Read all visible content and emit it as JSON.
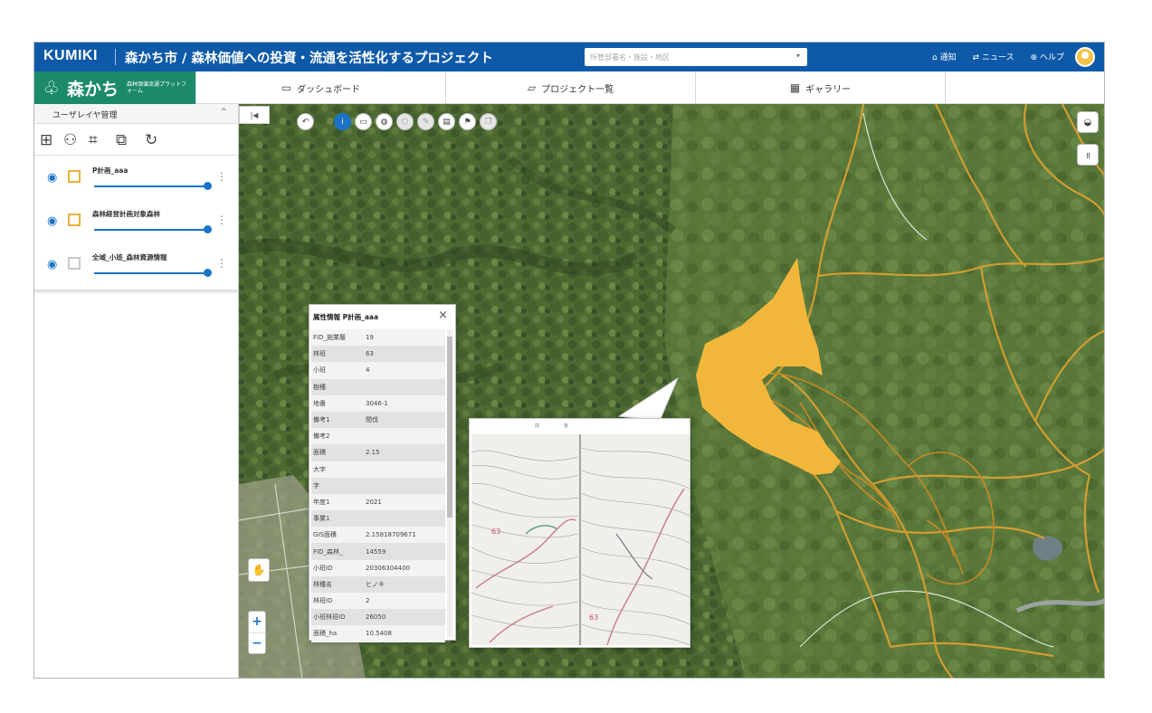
{
  "header": {
    "brand": "KUMIKI",
    "project_title": "森かち市 / 森林価値への投資・流通を活性化するプロジェクト",
    "search_placeholder": "所管部署名・施設・地区",
    "nav": [
      "通知",
      "ニュース",
      "ヘルプ"
    ]
  },
  "logo": {
    "mark": "♧",
    "name": "森かち",
    "tagline": "森林価値流通プラットフォーム"
  },
  "tabs": [
    {
      "label": "ダッシュボード",
      "icon": "monitor-icon"
    },
    {
      "label": "プロジェクト一覧",
      "icon": "folder-icon"
    },
    {
      "label": "ギャラリー",
      "icon": "gallery-icon"
    }
  ],
  "left_panel": {
    "title": "ユーザレイヤ管理",
    "collapse": "^",
    "layers": [
      {
        "name": "P計画_aaa",
        "opacity": 1.0,
        "color": "#e7b13a"
      },
      {
        "name": "森林経営計画対象森林",
        "opacity": 1.0,
        "color": "#e7b13a"
      },
      {
        "name": "全域_小班_森林資源情報",
        "opacity": 1.0,
        "color": "#c9c9c9"
      }
    ]
  },
  "map": {
    "collapse_label": "|◀",
    "zoom_in": "+",
    "zoom_out": "−"
  },
  "popup": {
    "title": "属性情報 P計画_aaa",
    "close": "×",
    "rows": [
      [
        "FID_施業履",
        "19"
      ],
      [
        "林班",
        "63"
      ],
      [
        "小班",
        "4"
      ],
      [
        "樹種",
        ""
      ],
      [
        "地番",
        "3046-1"
      ],
      [
        "備考1",
        "間伐"
      ],
      [
        "備考2",
        ""
      ],
      [
        "面積",
        "2.15"
      ],
      [
        "大字",
        ""
      ],
      [
        "字",
        ""
      ],
      [
        "年度1",
        "2021"
      ],
      [
        "事業1",
        ""
      ],
      [
        "GIS面積",
        "2.15818709671"
      ],
      [
        "FID_森林_",
        "14559"
      ],
      [
        "小班ID",
        "20306304400"
      ],
      [
        "林種名",
        "ヒノキ"
      ],
      [
        "林班ID",
        "2"
      ],
      [
        "小班林班ID",
        "26050"
      ],
      [
        "面積_ha",
        "10.5408"
      ]
    ]
  },
  "callout": {
    "left_label": "前",
    "right_label": "後"
  },
  "colors": {
    "header_blue": "#0f5aa8",
    "logo_green": "#1b8a6b",
    "accent_blue": "#1a73c8",
    "polygon_yellow": "#f2b73a"
  }
}
